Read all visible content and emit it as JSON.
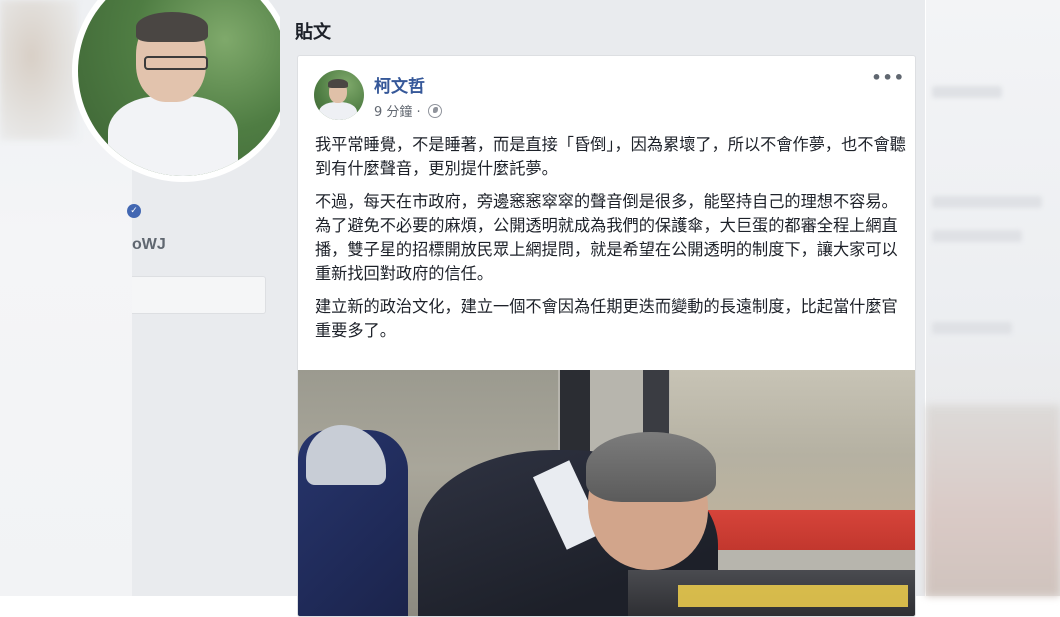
{
  "left_sidebar": {
    "handle": "oWJ",
    "verified_badge": "✓"
  },
  "feed": {
    "section_title": "貼文"
  },
  "post": {
    "author": "柯文哲",
    "timestamp": "9 分鐘",
    "separator": "·",
    "privacy_icon": "globe-icon",
    "more_options": "•••",
    "paragraphs": [
      "我平常睡覺，不是睡著，而是直接「昏倒」，因為累壞了，所以不會作夢，也不會聽到有什麼聲音，更別提什麼託夢。",
      "不過，每天在市政府，旁邊窸窸窣窣的聲音倒是很多，能堅持自己的理想不容易。為了避免不必要的麻煩，公開透明就成為我們的保護傘，大巨蛋的都審全程上網直播，雙子星的招標開放民眾上網提問，就是希望在公開透明的制度下，讓大家可以重新找回對政府的信任。",
      "建立新的政治文化，建立一個不會因為任期更迭而變動的長遠制度，比起當什麼官重要多了。"
    ]
  },
  "colors": {
    "link_blue": "#365899",
    "feed_bg": "#e9ebee",
    "text": "#1d2129",
    "meta": "#616770"
  }
}
